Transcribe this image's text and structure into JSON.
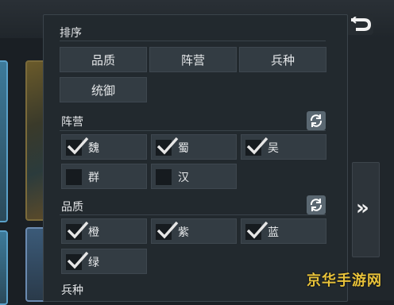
{
  "sort": {
    "title": "排序",
    "options": [
      "品质",
      "阵营",
      "兵种",
      "统御"
    ]
  },
  "faction": {
    "title": "阵营",
    "items": [
      {
        "label": "魏",
        "checked": true
      },
      {
        "label": "蜀",
        "checked": true
      },
      {
        "label": "吴",
        "checked": true
      },
      {
        "label": "群",
        "checked": false
      },
      {
        "label": "汉",
        "checked": false
      }
    ]
  },
  "quality": {
    "title": "品质",
    "items": [
      {
        "label": "橙",
        "checked": true
      },
      {
        "label": "紫",
        "checked": true
      },
      {
        "label": "蓝",
        "checked": true
      },
      {
        "label": "绿",
        "checked": true
      }
    ]
  },
  "troop": {
    "title": "兵种"
  },
  "expand": {
    "glyph": "»"
  },
  "watermark": {
    "text": "京华手游网"
  },
  "colors": {
    "accent": "#e8c23a",
    "panel": "#22292e",
    "button": "#333c43"
  }
}
